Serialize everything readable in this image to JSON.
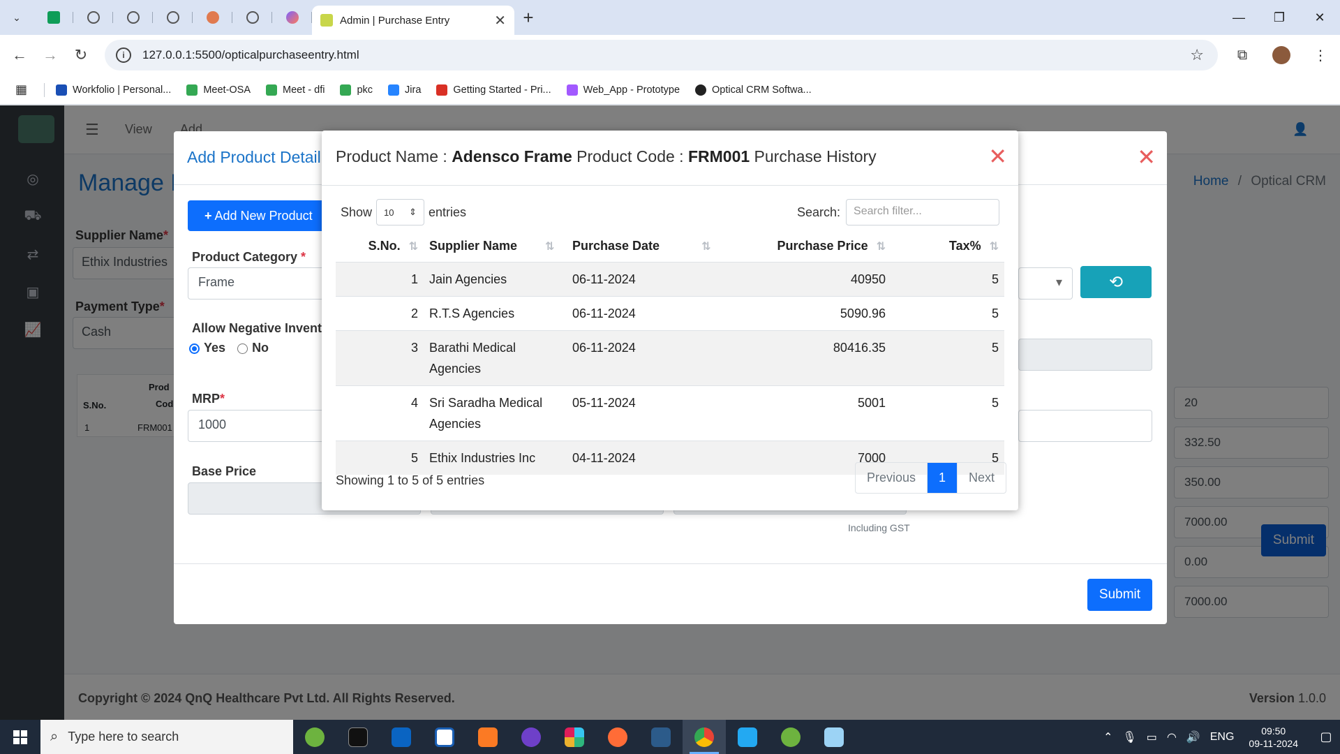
{
  "browser": {
    "active_tab_title": "Admin | Purchase Entry",
    "url": "127.0.0.1:5500/opticalpurchaseentry.html",
    "bookmarks": [
      {
        "label": "Workfolio | Personal...",
        "color": "#1a4fb5"
      },
      {
        "label": "Meet-OSA",
        "color": "#34a853"
      },
      {
        "label": "Meet - dfi",
        "color": "#34a853"
      },
      {
        "label": "pkc",
        "color": "#34a853"
      },
      {
        "label": "Jira",
        "color": "#2684ff"
      },
      {
        "label": "Getting Started - Pri...",
        "color": "#d93025"
      },
      {
        "label": "Web_App - Prototype",
        "color": "#a259ff"
      },
      {
        "label": "Optical CRM Softwa...",
        "color": "#222222"
      }
    ]
  },
  "app_bg": {
    "topbar_links": [
      "View",
      "Add"
    ],
    "page_title": "Manage P",
    "breadcrumb_home": "Home",
    "breadcrumb_sep": "/",
    "breadcrumb_current": "Optical CRM",
    "supplier_label": "Supplier Name",
    "supplier_value": "Ethix Industries",
    "payment_label": "Payment Type",
    "payment_value": "Cash",
    "table_head": [
      "S.No.",
      "Prod",
      "Cod"
    ],
    "table_row": [
      "1",
      "FRM001"
    ],
    "right_values": [
      "20",
      "332.50",
      "350.00",
      "7000.00",
      "0.00",
      "7000.00"
    ],
    "submit": "Submit",
    "footer_copy": "Copyright © 2024 QnQ Healthcare Pvt Ltd. All Rights Reserved.",
    "footer_version_label": "Version",
    "footer_version": "1.0.0"
  },
  "add_modal": {
    "title": "Add Product Detail",
    "add_new_product": "Add New Product",
    "product_category_label": "Product Category",
    "product_category_value": "Frame",
    "allow_negative_label": "Allow Negative Invent",
    "yes": "Yes",
    "no": "No",
    "mrp_label": "MRP",
    "mrp_value": "1000",
    "base_price_label": "Base Price",
    "including_gst": "Including GST",
    "submit": "Submit"
  },
  "history_modal": {
    "product_name_label": "Product Name :",
    "product_name": "Adensco Frame",
    "product_code_label": "Product Code :",
    "product_code": "FRM001",
    "suffix": "Purchase History",
    "show": "Show",
    "page_size": "10",
    "entries": "entries",
    "search_label": "Search:",
    "search_placeholder": "Search filter...",
    "columns": [
      "S.No.",
      "Supplier Name",
      "Purchase Date",
      "Purchase Price",
      "Tax%"
    ],
    "rows": [
      {
        "sno": "1",
        "supplier": "Jain Agencies",
        "date": "06-11-2024",
        "price": "40950",
        "tax": "5"
      },
      {
        "sno": "2",
        "supplier": "R.T.S Agencies",
        "date": "06-11-2024",
        "price": "5090.96",
        "tax": "5"
      },
      {
        "sno": "3",
        "supplier": "Barathi Medical Agencies",
        "date": "06-11-2024",
        "price": "80416.35",
        "tax": "5"
      },
      {
        "sno": "4",
        "supplier": "Sri Saradha Medical Agencies",
        "date": "05-11-2024",
        "price": "5001",
        "tax": "5"
      },
      {
        "sno": "5",
        "supplier": "Ethix Industries Inc",
        "date": "04-11-2024",
        "price": "7000",
        "tax": "5"
      }
    ],
    "info": "Showing 1 to 5 of 5 entries",
    "previous": "Previous",
    "current_page": "1",
    "next": "Next"
  },
  "taskbar": {
    "search_placeholder": "Type here to search",
    "lang": "ENG",
    "time": "09:50",
    "date": "09-11-2024"
  }
}
